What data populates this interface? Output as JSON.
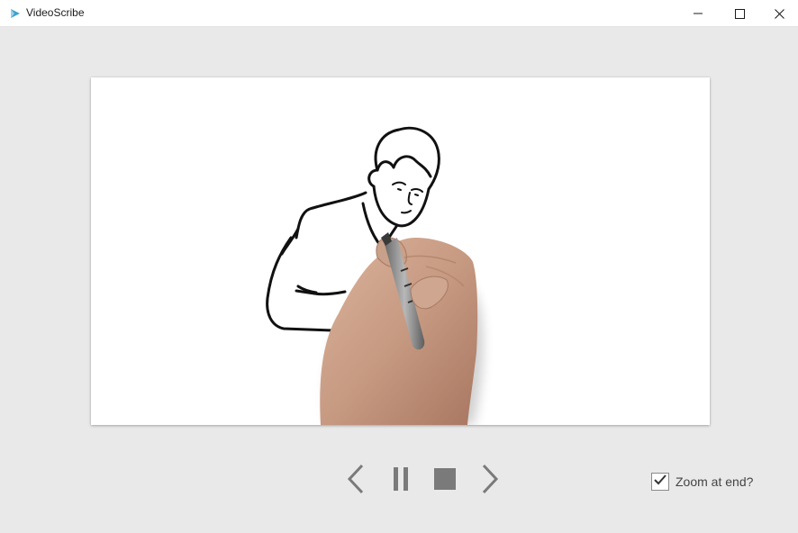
{
  "app": {
    "title": "VideoScribe",
    "icon": "videoscribe-logo-icon",
    "accent_color": "#3f9fcf"
  },
  "window_controls": {
    "minimize_icon": "minimize-icon",
    "maximize_icon": "maximize-icon",
    "close_icon": "close-icon"
  },
  "preview": {
    "illustration": "hand-drawing-businessman-illustration",
    "background_color": "#ffffff"
  },
  "playback": {
    "previous_icon": "chevron-left-icon",
    "pause_icon": "pause-icon",
    "stop_icon": "stop-icon",
    "next_icon": "chevron-right-icon",
    "control_color": "#7a7a7a"
  },
  "options": {
    "zoom_at_end_label": "Zoom at end?",
    "zoom_at_end_checked": true
  }
}
